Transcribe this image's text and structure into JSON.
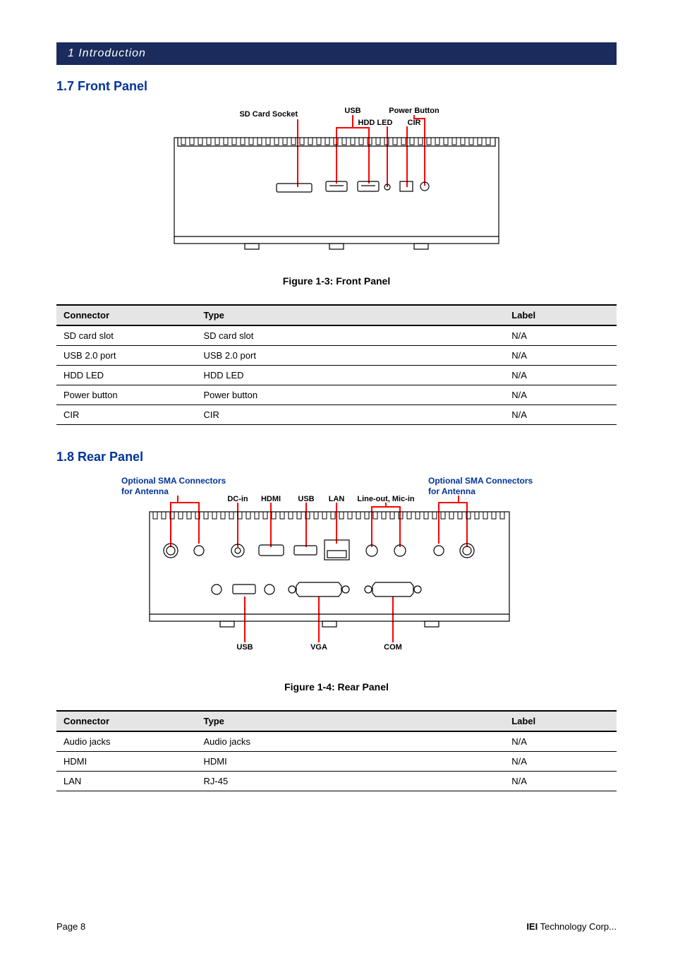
{
  "header": {
    "chapter": "1 Introduction"
  },
  "sections": {
    "front": {
      "title": "1.7 Front Panel"
    },
    "rear": {
      "title": "1.8 Rear Panel"
    }
  },
  "figures": {
    "front": {
      "labels": {
        "sd": "SD Card Socket",
        "usb": "USB",
        "hdd": "HDD LED",
        "power": "Power Button",
        "cir": "CIR"
      },
      "caption": "Figure 1-3: Front Panel"
    },
    "rear": {
      "labels": {
        "sma_left": "Optional SMA Connectors for Antenna",
        "sma_right": "Optional SMA Connectors for Antenna",
        "dcin": "DC-in",
        "hdmi": "HDMI",
        "usb_top": "USB",
        "lan": "LAN",
        "audio": "Line-out, Mic-in",
        "usb_bot": "USB",
        "vga": "VGA",
        "com": "COM"
      },
      "caption": "Figure 1-4: Rear Panel"
    }
  },
  "tables": {
    "front": {
      "headers": {
        "c1": "Connector",
        "c2": "Type",
        "c3": "Label"
      },
      "rows": [
        {
          "c1": "SD card slot",
          "c2": "SD card slot",
          "c3": "N/A"
        },
        {
          "c1": "USB 2.0 port",
          "c2": "USB 2.0 port",
          "c3": "N/A"
        },
        {
          "c1": "HDD LED",
          "c2": "HDD LED",
          "c3": "N/A"
        },
        {
          "c1": "Power button",
          "c2": "Power button",
          "c3": "N/A"
        },
        {
          "c1": "CIR",
          "c2": "CIR",
          "c3": "N/A"
        }
      ]
    },
    "rear": {
      "headers": {
        "c1": "Connector",
        "c2": "Type",
        "c3": "Label"
      },
      "rows": [
        {
          "c1": "Audio jacks",
          "c2": "Audio jacks",
          "c3": "N/A"
        },
        {
          "c1": "HDMI",
          "c2": "HDMI",
          "c3": "N/A"
        },
        {
          "c1": "LAN",
          "c2": "RJ-45",
          "c3": "N/A"
        }
      ]
    }
  },
  "footer": {
    "left": "Page 8",
    "right_bold": "IEI",
    "right_rest": " Technology Corp..."
  }
}
